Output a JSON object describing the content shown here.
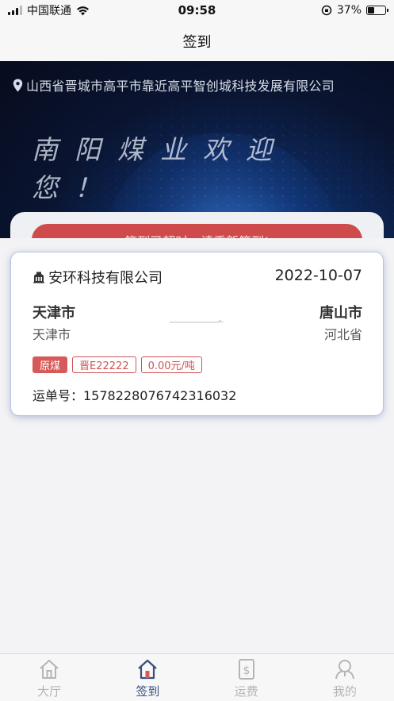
{
  "status_bar": {
    "carrier": "中国联通",
    "time": "09:58",
    "battery": "37%",
    "battery_level": 0.37
  },
  "header": {
    "title": "签到"
  },
  "banner": {
    "location": "山西省晋城市高平市靠近高平智创城科技发展有限公司",
    "welcome_text": "南阳煤业欢迎您！",
    "signin_button": "签到已超时，请重新签到!"
  },
  "order": {
    "company": "安环科技有限公司",
    "date": "2022-10-07",
    "origin_city": "天津市",
    "origin_province": "天津市",
    "destination_city": "唐山市",
    "destination_province": "河北省",
    "tags": [
      "原煤",
      "晋E22222",
      "0.00元/吨"
    ],
    "waybill": "运单号：1578228076742316032"
  },
  "tab_bar": {
    "items": [
      {
        "label": "大厅",
        "icon": "home-icon",
        "active": false
      },
      {
        "label": "签到",
        "icon": "checkin-icon",
        "active": true
      },
      {
        "label": "运费",
        "icon": "freight-icon",
        "active": false
      },
      {
        "label": "我的",
        "icon": "profile-icon",
        "active": false
      }
    ]
  },
  "colors": {
    "accent_red": "#d05454",
    "active_tab": "#3a4f7d",
    "inactive_tab": "#b5b5b5"
  }
}
